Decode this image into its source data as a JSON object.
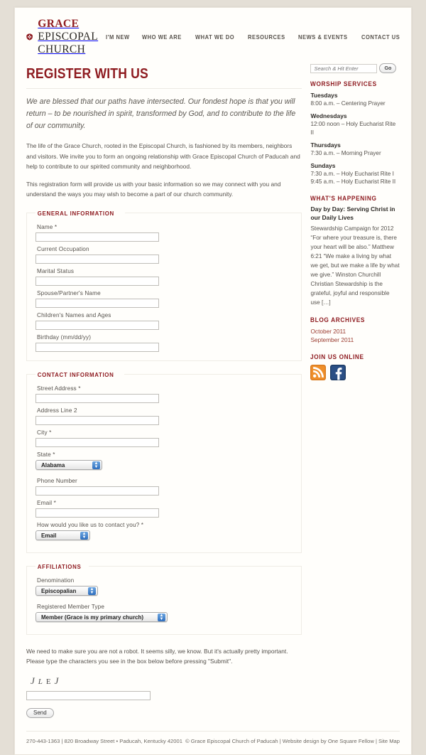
{
  "site": {
    "brand_first": "GRACE",
    "brand_rest": "EPISCOPAL CHURCH",
    "logo_icon": "shield-cross-icon"
  },
  "nav": {
    "items": [
      {
        "label": "I'M NEW"
      },
      {
        "label": "WHO WE ARE"
      },
      {
        "label": "WHAT WE DO"
      },
      {
        "label": "RESOURCES"
      },
      {
        "label": "NEWS & EVENTS"
      },
      {
        "label": "CONTACT US"
      }
    ]
  },
  "page": {
    "title": "REGISTER WITH US",
    "lede": "We are blessed that our paths have intersected. Our fondest hope is that you will return – to be nourished in spirit, transformed by God, and to contribute to the life of our community.",
    "paragraph1": "The life of the Grace Church, rooted in the Episcopal Church, is fashioned by its members, neighbors and visitors. We invite you to form an ongoing relationship with Grace Episcopal Church of Paducah and help to contribute to our spirited community and neighborhood.",
    "paragraph2": "This registration form will provide us with your basic information so we may connect with you and understand the ways you may wish to become a part of our church community."
  },
  "form": {
    "general": {
      "legend": "GENERAL INFORMATION",
      "fields": [
        {
          "label": "Name *",
          "value": "",
          "type": "text"
        },
        {
          "label": "Current Occupation",
          "value": "",
          "type": "text"
        },
        {
          "label": "Marital Status",
          "value": "",
          "type": "text"
        },
        {
          "label": "Spouse/Partner's Name",
          "value": "",
          "type": "text"
        },
        {
          "label": "Children's Names and Ages",
          "value": "",
          "type": "text"
        },
        {
          "label": "Birthday (mm/dd/yy)",
          "value": "",
          "type": "text"
        }
      ]
    },
    "contact": {
      "legend": "CONTACT INFORMATION",
      "street_label": "Street Address *",
      "street_value": "",
      "address2_label": "Address Line 2",
      "address2_value": "",
      "city_label": "City *",
      "city_value": "",
      "state_label": "State *",
      "state_value": "Alabama",
      "phone_label": "Phone Number",
      "phone_value": "",
      "email_label": "Email *",
      "email_value": "",
      "contact_pref_label": "How would you like us to contact you? *",
      "contact_pref_value": "Email"
    },
    "affiliations": {
      "legend": "AFFILIATIONS",
      "denomination_label": "Denomination",
      "denomination_value": "Episcopalian",
      "member_label": "Registered Member Type",
      "member_value": "Member (Grace is my primary church)"
    },
    "captcha": {
      "intro": "We need to make sure you are not a robot. It seems silly, we know. But it's actually pretty important. Please type the characters you see in the box below before pressing \"Submit\".",
      "glyphs": [
        "J",
        "L",
        "E",
        "J"
      ],
      "input_value": "",
      "submit_label": "Send"
    }
  },
  "sidebar": {
    "search": {
      "placeholder": "Search & Hit Enter",
      "value": "",
      "button_label": "Go"
    },
    "worship": {
      "heading": "WORSHIP SERVICES",
      "days": [
        {
          "day": "Tuesdays",
          "times": [
            "8:00 a.m. – Centering Prayer"
          ]
        },
        {
          "day": "Wednesdays",
          "times": [
            "12:00 noon – Holy Eucharist Rite II"
          ]
        },
        {
          "day": "Thursdays",
          "times": [
            "7:30 a.m. – Morning Prayer"
          ]
        },
        {
          "day": "Sundays",
          "times": [
            "7:30 a.m. – Holy Eucharist Rite I",
            "9:45 a.m. – Holy Eucharist Rite II"
          ]
        }
      ]
    },
    "happening": {
      "heading": "WHAT'S HAPPENING",
      "post_title": "Day by Day: Serving Christ in our Daily Lives",
      "post_excerpt": "Stewardship Campaign for 2012 “For where your treasure is, there your heart will be also.” Matthew 6:21 “We make a living by what we get, but we make a life by what we give.” Winston Churchill Christian Stewardship is the grateful, joyful and responsible use […]"
    },
    "archives": {
      "heading": "BLOG ARCHIVES",
      "links": [
        "October 2011",
        "September 2011"
      ]
    },
    "social": {
      "heading": "JOIN US ONLINE",
      "icons": [
        "rss-icon",
        "facebook-icon"
      ]
    }
  },
  "footer": {
    "left": "270-443-1363 | 820 Broadway Street • Paducah, Kentucky 42001",
    "right": "© Grace Episcopal Church of Paducah | Website design by One Square Fellow | Site Map"
  },
  "colors": {
    "accent_red": "#8e1b20",
    "link_red": "#9a3a2e",
    "page_bg": "#e4dfd6",
    "content_bg": "#fffefb"
  }
}
